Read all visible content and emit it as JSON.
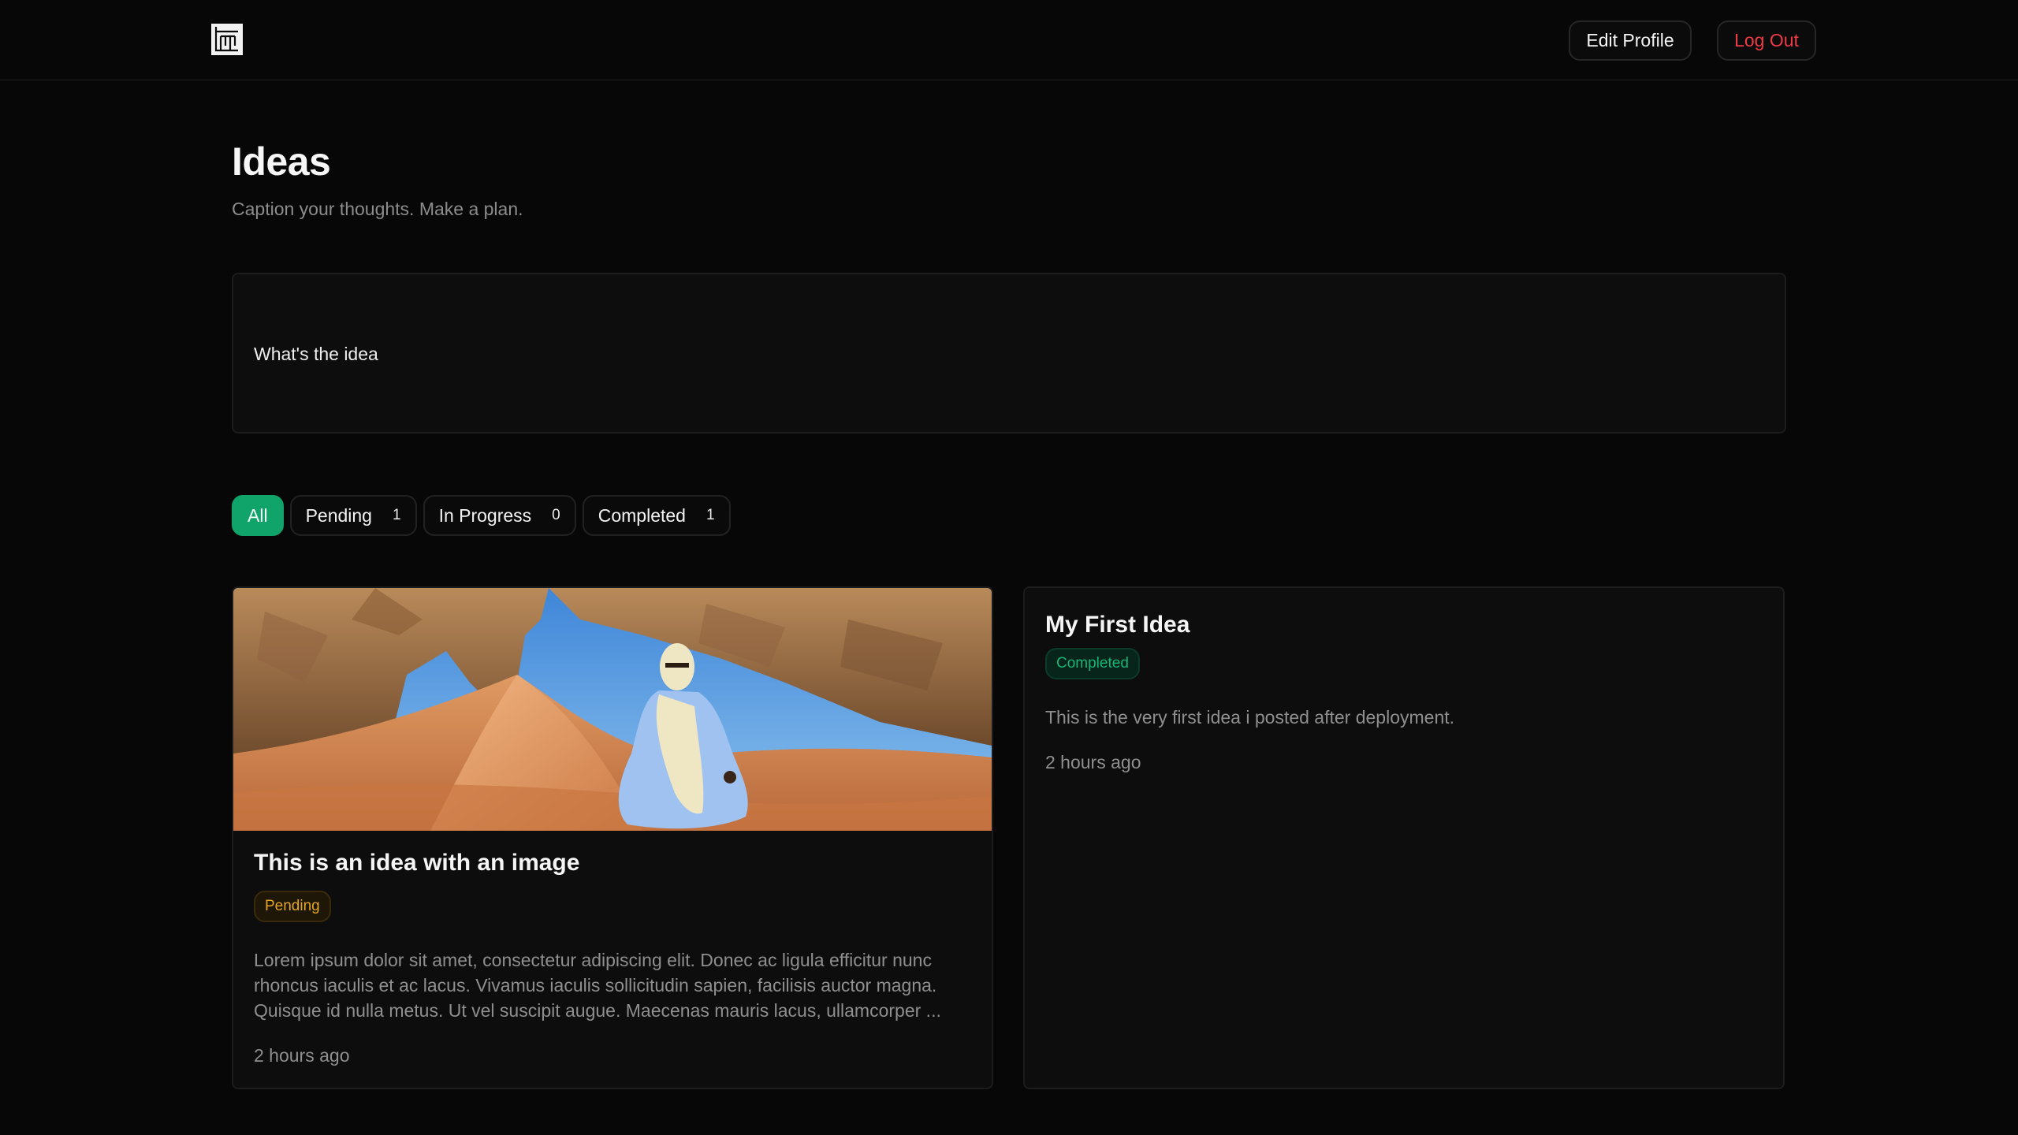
{
  "header": {
    "edit_profile": "Edit Profile",
    "log_out": "Log Out"
  },
  "page": {
    "title": "Ideas",
    "subtitle": "Caption your thoughts. Make a plan."
  },
  "composer": {
    "placeholder": "What's the idea",
    "value": ""
  },
  "filters": [
    {
      "label": "All",
      "count": "",
      "active": true
    },
    {
      "label": "Pending",
      "count": "1",
      "active": false
    },
    {
      "label": "In Progress",
      "count": "0",
      "active": false
    },
    {
      "label": "Completed",
      "count": "1",
      "active": false
    }
  ],
  "ideas": [
    {
      "title": "This is an idea with an image",
      "status": "Pending",
      "description": "Lorem ipsum dolor sit amet, consectetur adipiscing elit. Donec ac ligula efficitur nunc rhoncus iaculis et ac lacus. Vivamus iaculis sollicitudin sapien, facilisis auctor magna. Quisque id nulla metus. Ut vel suscipit augue. Maecenas mauris lacus, ullamcorper ...",
      "time": "2 hours ago"
    },
    {
      "title": "My First Idea",
      "status": "Completed",
      "description": "This is the very first idea i posted after deployment.",
      "time": "2 hours ago"
    }
  ],
  "colors": {
    "accent": "#10a36a",
    "danger": "#ef3b46",
    "pending": "#e3a523",
    "completed": "#14b577"
  },
  "icons": {
    "logo": "app-logo-icon"
  }
}
